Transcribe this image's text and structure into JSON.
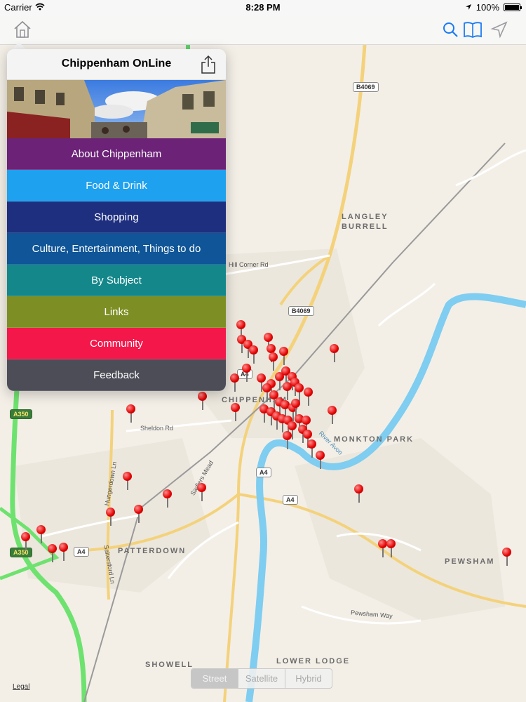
{
  "status_bar": {
    "carrier": "Carrier",
    "time": "8:28 PM",
    "battery": "100%",
    "battery_level": 1.0
  },
  "toolbar": {
    "icons": [
      "home-icon",
      "search-icon",
      "book-icon",
      "location-arrow-icon"
    ]
  },
  "popover": {
    "title": "Chippenham OnLine",
    "menu": [
      {
        "label": "About Chippenham",
        "color": "#6b2277"
      },
      {
        "label": "Food & Drink",
        "color": "#1ea1ee"
      },
      {
        "label": "Shopping",
        "color": "#1f2f80"
      },
      {
        "label": "Culture, Entertainment, Things to do",
        "color": "#0f5597"
      },
      {
        "label": "By Subject",
        "color": "#14878a"
      },
      {
        "label": "Links",
        "color": "#7d8f24"
      },
      {
        "label": "Community",
        "color": "#f4174a"
      },
      {
        "label": "Feedback",
        "color": "#4c4d57"
      }
    ]
  },
  "map": {
    "places": [
      "LANGLEY\nBURRELL",
      "CHIPPENHAM",
      "MONKTON PARK",
      "PATTERDOWN",
      "PEWSHAM",
      "SHOWELL",
      "LOWER LODGE"
    ],
    "roads": [
      "B4069",
      "B4069",
      "A4",
      "A4",
      "A4",
      "A4",
      "A350",
      "A350",
      "Hill Corner Rd",
      "Sheldon Rd",
      "Hungerdown Ln",
      "Sadlers Mead",
      "River Avon",
      "Pewsham Way",
      "Saltersford Ln"
    ],
    "legal": "Legal"
  },
  "map_type": {
    "options": [
      "Street",
      "Satellite",
      "Hybrid"
    ],
    "selected": "Street"
  }
}
